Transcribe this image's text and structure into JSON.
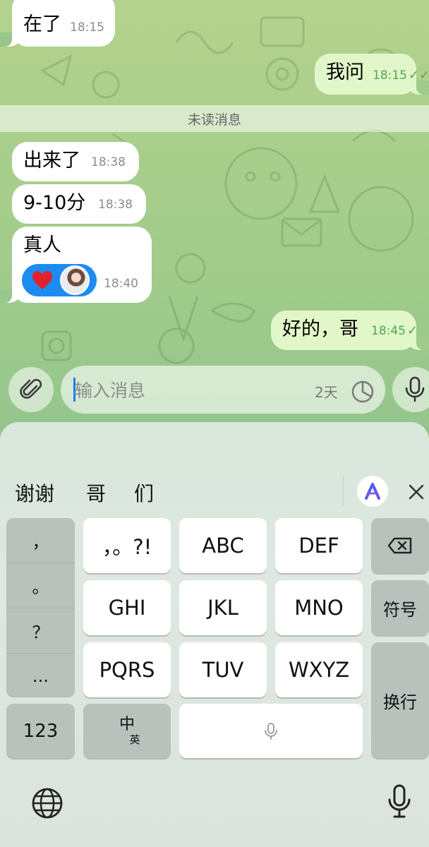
{
  "messages": {
    "m1": {
      "text": "在了",
      "time": "18:15"
    },
    "m2": {
      "text": "我问",
      "time": "18:15",
      "status": "read"
    },
    "unread_divider": "未读消息",
    "m3": {
      "text": "出来了",
      "time": "18:38"
    },
    "m4": {
      "text": "9-10分",
      "time": "18:38"
    },
    "m5": {
      "text": "真人",
      "time": "18:40",
      "reaction": "heart"
    },
    "m6": {
      "text": "好的，哥",
      "time": "18:45",
      "status": "sent"
    }
  },
  "composer": {
    "placeholder": "输入消息",
    "timer_label": "2天"
  },
  "keyboard": {
    "candidates": [
      "谢谢",
      "哥",
      "们"
    ],
    "punct_column": [
      "，",
      "。",
      "？",
      "..."
    ],
    "keys": {
      "row1": [
        "，。?!",
        "ABC",
        "DEF"
      ],
      "row2": [
        "GHI",
        "JKL",
        "MNO"
      ],
      "row3": [
        "PQRS",
        "TUV",
        "WXYZ"
      ],
      "symbols": "符号",
      "return": "换行",
      "numbers": "123",
      "lang_main": "中",
      "lang_sub": "英"
    }
  },
  "colors": {
    "incoming_bubble": "#ffffff",
    "outgoing_bubble": "#e2f7c9",
    "outgoing_time": "#4da94a",
    "reaction_bg": "#1c8cf2",
    "caret": "#1f7ef3"
  }
}
